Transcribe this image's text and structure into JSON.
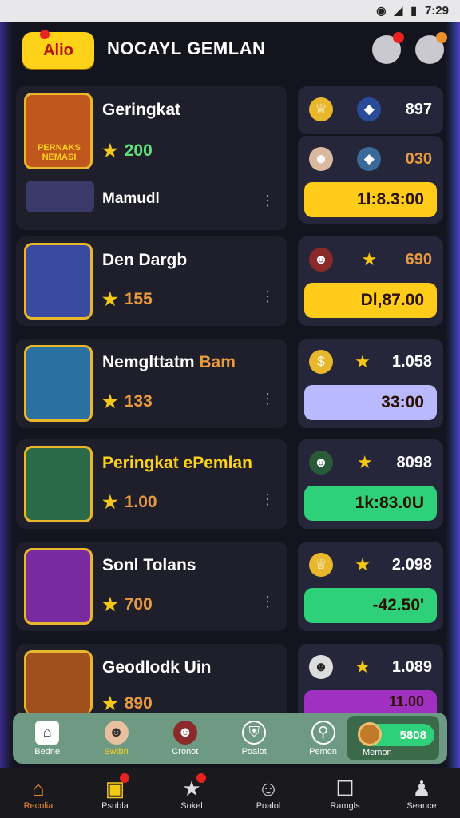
{
  "status": {
    "time": "7:29"
  },
  "header": {
    "pill": "Alio",
    "title": "NOCAYL GEMLAN"
  },
  "rows": [
    {
      "name": "Geringkat",
      "score": "200",
      "extra": "Mamudl",
      "side_value": "897",
      "side2_value": "030",
      "bar": "1l:8.3:00",
      "bar_color": "#ffcc1a",
      "av_bg": "#c0571c",
      "av_text": "PERNAKS NEMASI"
    },
    {
      "name": "Den Dargb",
      "score": "155",
      "side_value": "690",
      "bar": "Dl,87.00",
      "bar_color": "#ffcc1a",
      "av_bg": "#3a4aa0"
    },
    {
      "name": "Nemglttatm",
      "name_accent": "Bam",
      "score": "133",
      "side_value": "1.058",
      "bar": "33:00",
      "bar_color": "#b9b9ff",
      "av_bg": "#2a70a0"
    },
    {
      "name": "Peringkat ePemlan",
      "score": "1.00",
      "side_value": "8098",
      "bar": "1k:83.0U",
      "bar_color": "#2fd07a",
      "av_bg": "#2a6a48"
    },
    {
      "name": "Sonl Tolans",
      "score": "700",
      "side_value": "2.098",
      "bar": "-42.50'",
      "bar_color": "#2fd07a",
      "av_bg": "#7a2aa0"
    },
    {
      "name": "Geodlodk Uin",
      "score": "890",
      "side_value": "1.089",
      "bar": "11.00",
      "bar_color": "#a030c0",
      "av_bg": "#a0501c"
    }
  ],
  "dock": [
    {
      "label": "Bedne",
      "icon": "home-icon"
    },
    {
      "label": "Swtbn",
      "icon": "avatar-icon"
    },
    {
      "label": "Cronot",
      "icon": "avatar-icon"
    },
    {
      "label": "Poalot",
      "icon": "shield-icon"
    },
    {
      "label": "Pemon",
      "icon": "search-icon"
    }
  ],
  "wallet": {
    "count": "5808",
    "label": "Memon"
  },
  "nav": [
    {
      "label": "Recolia",
      "icon": "home-icon"
    },
    {
      "label": "Psnbla",
      "icon": "box-icon"
    },
    {
      "label": "Sokel",
      "icon": "star-icon"
    },
    {
      "label": "Poalol",
      "icon": "profile-icon"
    },
    {
      "label": "Ramgls",
      "icon": "clipboard-icon"
    },
    {
      "label": "Seance",
      "icon": "user-icon"
    }
  ]
}
